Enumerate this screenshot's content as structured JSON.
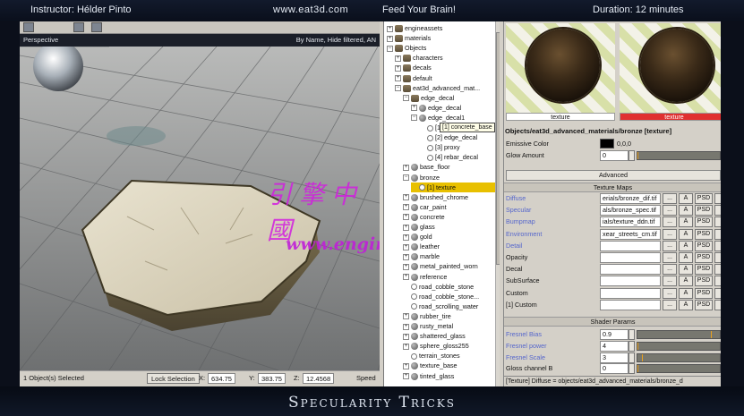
{
  "banner": {
    "instructor": "Instructor: Hélder Pinto",
    "site": "www.eat3d.com",
    "tagline": "Feed Your Brain!",
    "duration": "Duration: 12 minutes"
  },
  "footer": {
    "title": "Specularity Tricks"
  },
  "viewport": {
    "label": "Perspective",
    "filter": "By Name, Hide filtered, AN"
  },
  "statusbar": {
    "selected": "1 Object(s) Selected",
    "lock_label": "Lock Selection",
    "x_label": "X:",
    "x_value": "634.75",
    "y_label": "Y:",
    "y_value": "383.75",
    "z_label": "Z:",
    "z_value": "12.4568",
    "speed_label": "Speed"
  },
  "tree": {
    "tooltip": "[1] concrete_base",
    "items": [
      {
        "label": "engineassets",
        "pm": "+",
        "icon": "folder",
        "indent": 0
      },
      {
        "label": "materials",
        "pm": "+",
        "icon": "folder",
        "indent": 0
      },
      {
        "label": "Objects",
        "pm": "−",
        "icon": "folder",
        "indent": 0
      },
      {
        "label": "characters",
        "pm": "+",
        "icon": "folder",
        "indent": 1
      },
      {
        "label": "decals",
        "pm": "+",
        "icon": "folder",
        "indent": 1
      },
      {
        "label": "default",
        "pm": "+",
        "icon": "folder",
        "indent": 1
      },
      {
        "label": "eat3d_advanced_mat...",
        "pm": "−",
        "icon": "folder",
        "indent": 1
      },
      {
        "label": "edge_decal",
        "pm": "−",
        "icon": "folder",
        "indent": 2
      },
      {
        "label": "edge_decal",
        "pm": "+",
        "icon": "material",
        "indent": 3
      },
      {
        "label": "edge_decal1",
        "pm": "−",
        "icon": "material",
        "indent": 3
      },
      {
        "label": "[1] concrete_base",
        "pm": "",
        "icon": "texture",
        "indent": 4
      },
      {
        "label": "[2] edge_decal",
        "pm": "",
        "icon": "texture",
        "indent": 4
      },
      {
        "label": "[3] proxy",
        "pm": "",
        "icon": "texture",
        "indent": 4
      },
      {
        "label": "[4] rebar_decal",
        "pm": "",
        "icon": "texture",
        "indent": 4
      },
      {
        "label": "base_floor",
        "pm": "+",
        "icon": "material",
        "indent": 2
      },
      {
        "label": "bronze",
        "pm": "−",
        "icon": "material",
        "indent": 2
      },
      {
        "label": "[1] texture",
        "pm": "",
        "icon": "texture",
        "indent": 3,
        "selected": true
      },
      {
        "label": "brushed_chrome",
        "pm": "+",
        "icon": "material",
        "indent": 2
      },
      {
        "label": "car_paint",
        "pm": "+",
        "icon": "material",
        "indent": 2
      },
      {
        "label": "concrete",
        "pm": "+",
        "icon": "material",
        "indent": 2
      },
      {
        "label": "glass",
        "pm": "+",
        "icon": "material",
        "indent": 2
      },
      {
        "label": "gold",
        "pm": "+",
        "icon": "material",
        "indent": 2
      },
      {
        "label": "leather",
        "pm": "+",
        "icon": "material",
        "indent": 2
      },
      {
        "label": "marble",
        "pm": "+",
        "icon": "material",
        "indent": 2
      },
      {
        "label": "metal_painted_worn",
        "pm": "+",
        "icon": "material",
        "indent": 2
      },
      {
        "label": "reference",
        "pm": "+",
        "icon": "material",
        "indent": 2
      },
      {
        "label": "road_cobble_stone",
        "pm": "",
        "icon": "texture",
        "indent": 2
      },
      {
        "label": "road_cobble_stone...",
        "pm": "",
        "icon": "texture",
        "indent": 2
      },
      {
        "label": "road_scrolling_water",
        "pm": "",
        "icon": "texture",
        "indent": 2
      },
      {
        "label": "rubber_tire",
        "pm": "+",
        "icon": "material",
        "indent": 2
      },
      {
        "label": "rusty_metal",
        "pm": "+",
        "icon": "material",
        "indent": 2
      },
      {
        "label": "shattered_glass",
        "pm": "+",
        "icon": "material",
        "indent": 2
      },
      {
        "label": "sphere_gloss255",
        "pm": "+",
        "icon": "material",
        "indent": 2
      },
      {
        "label": "terrain_stones",
        "pm": "",
        "icon": "texture",
        "indent": 2
      },
      {
        "label": "texture_base",
        "pm": "+",
        "icon": "material",
        "indent": 2
      },
      {
        "label": "tinted_glass",
        "pm": "+",
        "icon": "material",
        "indent": 2
      }
    ]
  },
  "props": {
    "preview_left_label": "texture",
    "preview_right_label": "texture",
    "path": "Objects/eat3d_advanced_materials/bronze [texture]",
    "emissive_label": "Emissive Color",
    "emissive_value": "0,0,0",
    "glow_label": "Glow Amount",
    "glow_value": "0",
    "glow_fraction": 0.0,
    "advanced_label": "Advanced",
    "texture_maps_label": "Texture Maps",
    "ellipsis": "...",
    "a_label": "A",
    "psd_label": "PSD",
    "maps": [
      {
        "label": "Diffuse",
        "value": "erials/bronze_dif.tif",
        "link": true
      },
      {
        "label": "Specular",
        "value": "als/bronze_spec.tif",
        "link": true
      },
      {
        "label": "Bumpmap",
        "value": "ials/texture_ddn.tif",
        "link": true
      },
      {
        "label": "Environment",
        "value": "xear_streets_cm.tif",
        "link": true
      },
      {
        "label": "Detail",
        "value": "",
        "link": true
      },
      {
        "label": "Opacity",
        "value": "",
        "link": false
      },
      {
        "label": "Decal",
        "value": "",
        "link": false
      },
      {
        "label": "SubSurface",
        "value": "",
        "link": false
      },
      {
        "label": "Custom",
        "value": "",
        "link": false
      },
      {
        "label": "[1] Custom",
        "value": "",
        "link": false
      }
    ],
    "shader_params_label": "Shader Params",
    "params": [
      {
        "label": "Fresnel Bias",
        "value": "0.9",
        "fraction": 0.9,
        "link": true
      },
      {
        "label": "Fresnel power",
        "value": "4",
        "fraction": 0.0,
        "link": true
      },
      {
        "label": "Fresnel Scale",
        "value": "3",
        "fraction": 0.06,
        "link": true
      },
      {
        "label": "Gloss channel B",
        "value": "0",
        "fraction": 0.0,
        "link": false
      }
    ],
    "status": "[Texture] Diffuse = objects/eat3d_advanced_materials/bronze_d"
  },
  "watermark": {
    "line1": "引擎中國",
    "line2": "www.enginedx.com"
  },
  "colors": {
    "selection": "#e8c000",
    "active_preview": "#e03030",
    "link_label": "#5566cc"
  }
}
